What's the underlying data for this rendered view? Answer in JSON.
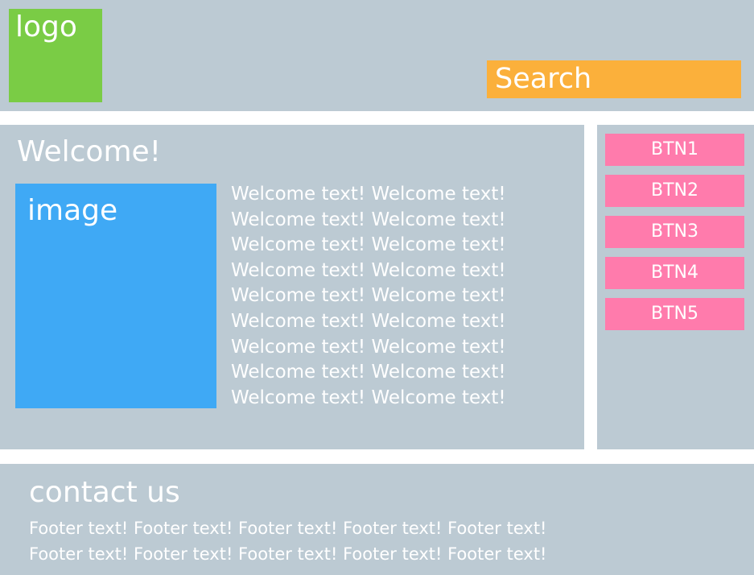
{
  "header": {
    "logo_label": "logo",
    "search_label": "Search"
  },
  "main": {
    "title": "Welcome!",
    "image_label": "image",
    "text_lines": [
      "Welcome text! Welcome text!",
      "Welcome text! Welcome text!",
      "Welcome text! Welcome text!",
      "Welcome text! Welcome text!",
      "Welcome text! Welcome text!",
      "Welcome text! Welcome text!",
      "Welcome text! Welcome text!",
      "Welcome text! Welcome text!",
      "Welcome text! Welcome text!"
    ]
  },
  "sidebar": {
    "buttons": [
      "BTN1",
      "BTN2",
      "BTN3",
      "BTN4",
      "BTN5"
    ]
  },
  "footer": {
    "title": "contact us",
    "text_lines": [
      "Footer text! Footer text! Footer text! Footer text! Footer text!",
      "Footer text! Footer text! Footer text! Footer text! Footer text!"
    ]
  },
  "colors": {
    "panel_bg": "#bccad3",
    "logo_bg": "#7acc45",
    "search_bg": "#fbb03b",
    "image_bg": "#3fa9f5",
    "button_bg": "#ff7bac",
    "text": "#ffffff"
  }
}
